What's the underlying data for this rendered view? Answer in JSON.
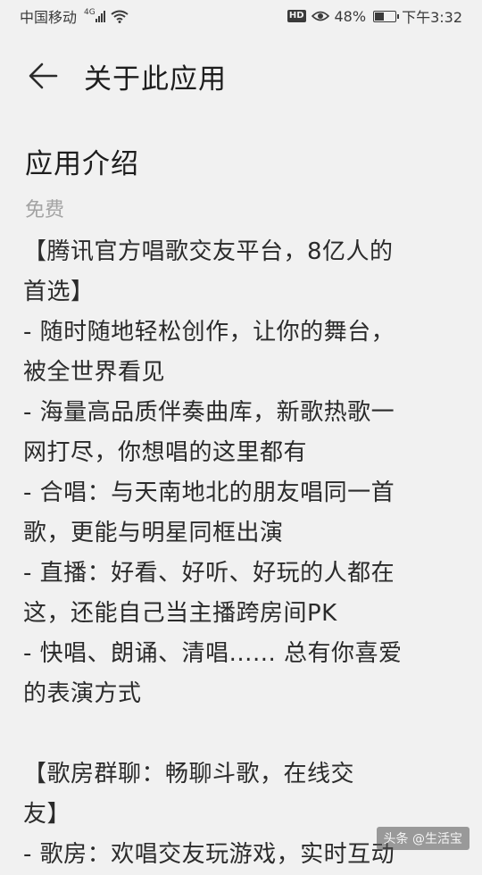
{
  "status_bar": {
    "carrier": "中国移动",
    "network_tag": "4G",
    "battery_text": "48%",
    "battery_level": 0.48,
    "time": "下午3:32",
    "hd_badge": "HD"
  },
  "header": {
    "back_icon": "back-arrow-icon",
    "title": "关于此应用"
  },
  "main": {
    "section_title": "应用介绍",
    "price": "免费",
    "description_lines": [
      "【腾讯官方唱歌交友平台，8亿人的",
      "首选】",
      "- 随时随地轻松创作，让你的舞台，",
      "被全世界看见",
      "- 海量高品质伴奏曲库，新歌热歌一",
      "网打尽，你想唱的这里都有",
      "- 合唱：与天南地北的朋友唱同一首",
      "歌，更能与明星同框出演",
      "- 直播：好看、好听、好玩的人都在",
      "这，还能自己当主播跨房间PK",
      "- 快唱、朗诵、清唱...... 总有你喜爱",
      "的表演方式",
      "",
      "【歌房群聊：畅聊斗歌，在线交",
      "友】",
      "- 歌房：欢唱交友玩游戏，实时互动"
    ]
  },
  "watermark": {
    "text": "头条 @生活宝"
  }
}
